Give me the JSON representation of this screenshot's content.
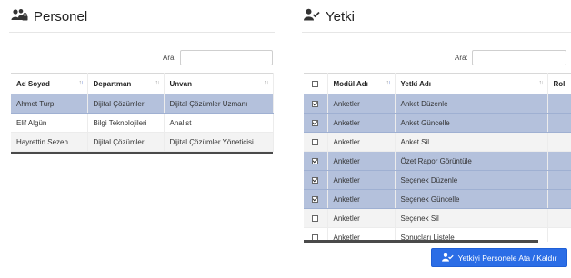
{
  "personel": {
    "title": "Personel",
    "icon": "users-lock-icon",
    "search_label": "Ara:",
    "columns": [
      "Ad Soyad",
      "Departman",
      "Unvan"
    ],
    "rows": [
      [
        "Ahmet Turp",
        "Dijital Çözümler",
        "Dijital Çözümler Uzmanı"
      ],
      [
        "Elif Algün",
        "Bilgi Teknolojileri",
        "Analist"
      ],
      [
        "Hayrettin Sezen",
        "Dijital Çözümler",
        "Dijital Çözümler Yöneticisi"
      ]
    ],
    "selected_row": 0
  },
  "yetki": {
    "title": "Yetki",
    "icon": "user-check-icon",
    "search_label": "Ara:",
    "columns": [
      "",
      "Modül Adı",
      "Yetki Adı",
      "Rol"
    ],
    "rows": [
      {
        "checked": true,
        "modul": "Anketler",
        "yetki": "Anket Düzenle"
      },
      {
        "checked": true,
        "modul": "Anketler",
        "yetki": "Anket Güncelle"
      },
      {
        "checked": false,
        "modul": "Anketler",
        "yetki": "Anket Sil"
      },
      {
        "checked": true,
        "modul": "Anketler",
        "yetki": "Özet Rapor Görüntüle"
      },
      {
        "checked": true,
        "modul": "Anketler",
        "yetki": "Seçenek Düzenle"
      },
      {
        "checked": true,
        "modul": "Anketler",
        "yetki": "Seçenek Güncelle"
      },
      {
        "checked": false,
        "modul": "Anketler",
        "yetki": "Seçenek Sil"
      },
      {
        "checked": false,
        "modul": "Anketler",
        "yetki": "Sonuçları Listele"
      }
    ]
  },
  "assign_button": {
    "label": "Yetkiyi Personele Ata / Kaldır",
    "icon": "user-check-icon",
    "color": "#2b6de6"
  },
  "colors": {
    "selected_row": "#b4c1dc",
    "alt_row": "#f3f3f3",
    "sort_active": "#3b62c6"
  }
}
